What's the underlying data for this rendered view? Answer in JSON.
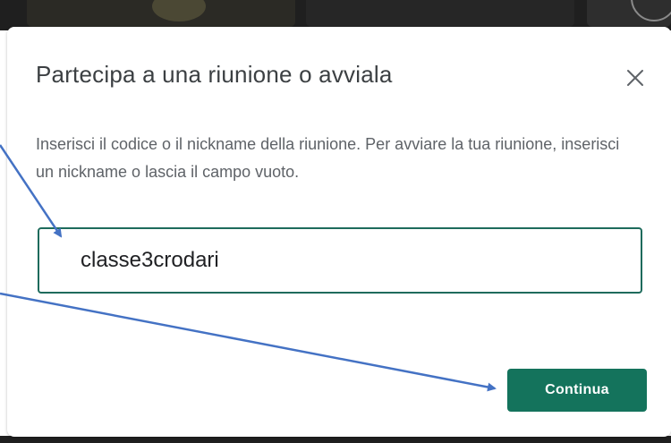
{
  "dialog": {
    "title": "Partecipa a una riunione o avviala",
    "description": "Inserisci il codice o il nickname della riunione. Per avviare la tua riunione, inserisci un nickname o lascia il campo vuoto.",
    "code_input_value": "classe3crodari",
    "continue_label": "Continua",
    "close_icon": "close-icon"
  },
  "colors": {
    "accent": "#14735c",
    "field_border": "#1e6b5c",
    "annotation_arrow": "#4472c4"
  }
}
